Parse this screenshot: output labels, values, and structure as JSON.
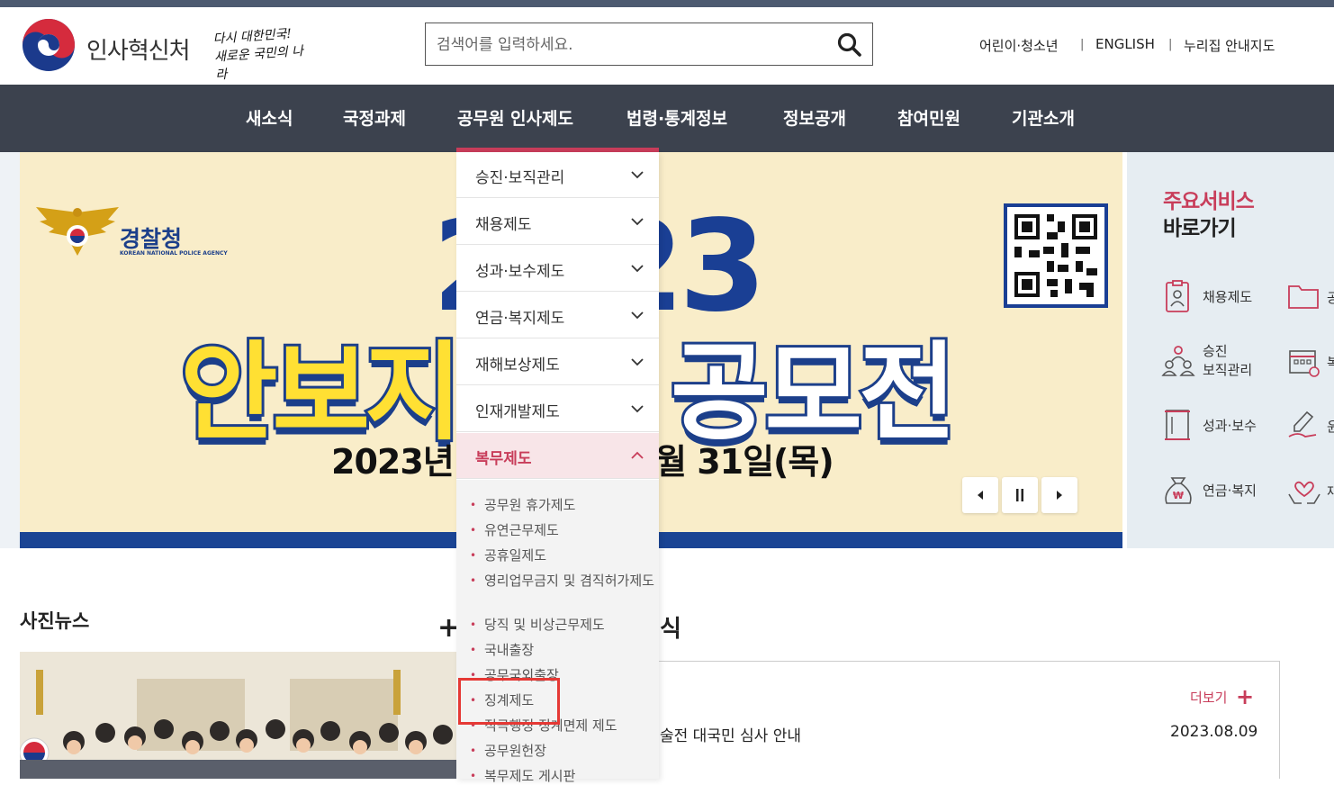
{
  "header": {
    "logo_text": "인사혁신처",
    "slogan_line1": "다시 대한민국!",
    "slogan_line2": "새로운 국민의 나라",
    "search_placeholder": "검색어를 입력하세요.",
    "util_links": [
      "어린이·청소년",
      "ENGLISH",
      "누리집 안내지도"
    ],
    "util_sep": "|"
  },
  "nav": {
    "items": [
      "새소식",
      "국정과제",
      "공무원 인사제도",
      "법령·통계정보",
      "정보공개",
      "참여민원",
      "기관소개"
    ]
  },
  "banner": {
    "agency": "경찰청",
    "agency_sub": "KOREAN NATIONAL POLICE AGENCY",
    "year": "2023",
    "title_left": "안보지",
    "title_right": "공모전",
    "date_left": "2023년 6",
    "date_right": "월 31일(목)",
    "controls": [
      "prev",
      "pause",
      "next"
    ]
  },
  "services": {
    "title1": "주요서비스",
    "title2": "바로가기",
    "items": [
      {
        "label": "채용제도",
        "icon": "document-person-icon"
      },
      {
        "label_line1": "승진",
        "label_line2": "보직관리",
        "icon": "people-icon"
      },
      {
        "label": "성과·보수",
        "icon": "scroll-icon"
      },
      {
        "label": "연금·복지",
        "icon": "money-bag-icon"
      }
    ],
    "partial_labels": [
      "공",
      "복",
      "윤",
      "재"
    ]
  },
  "dropdown": {
    "items": [
      "승진·보직관리",
      "채용제도",
      "성과·보수제도",
      "연금·복지제도",
      "재해보상제도",
      "인재개발제도",
      "복무제도"
    ],
    "active_index": 6,
    "sub_items": [
      "공무원 휴가제도",
      "유연근무제도",
      "공휴일제도",
      "영리업무금지 및 겸직허가제도",
      "당직 및 비상근무제도",
      "국내출장",
      "공무국외출장",
      "징계제도",
      "적극행정 징계면제 제도",
      "공무원헌장",
      "복무제도 게시판"
    ]
  },
  "photo_news": {
    "title": "사진뉴스",
    "plus": "+"
  },
  "news": {
    "title_fragment": "식",
    "more_label": "더보기",
    "more_plus": "+",
    "item_text": "술전 대국민 심사 안내",
    "item_date": "2023.08.09"
  },
  "colors": {
    "accent": "#c83d5a",
    "nav_bg": "#3c424e",
    "banner_blue": "#1a3f94",
    "highlight": "#e53935"
  }
}
